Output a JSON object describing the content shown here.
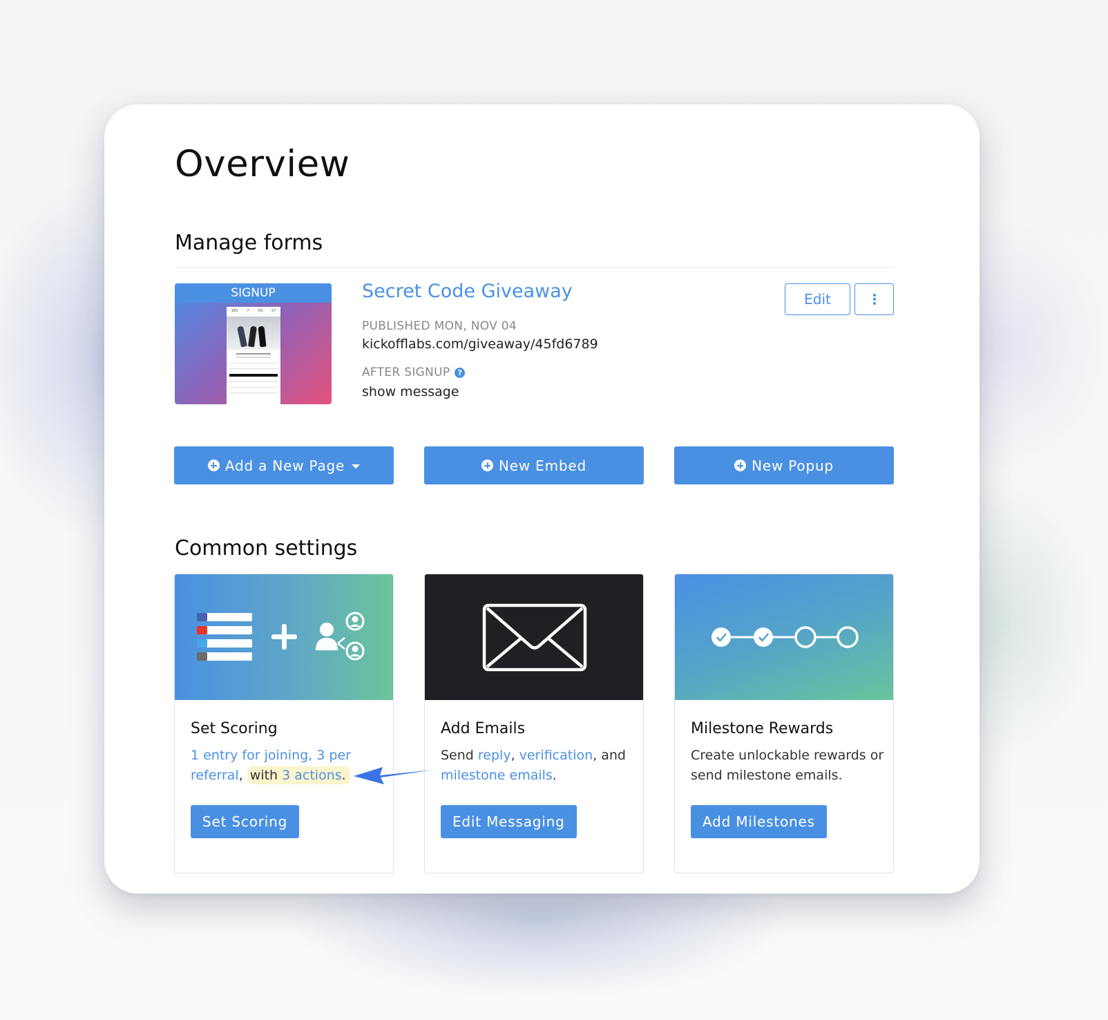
{
  "page": {
    "title": "Overview"
  },
  "manage_forms": {
    "heading": "Manage forms",
    "form": {
      "thumbnail_label": "SIGNUP",
      "title": "Secret Code Giveaway",
      "published_label": "PUBLISHED MON, NOV 04",
      "url": "kickofflabs.com/giveaway/45fd6789",
      "after_signup_label": "AFTER SIGNUP",
      "after_signup_help_icon": "question-circle-icon",
      "after_signup_value": "show message",
      "edit_label": "Edit",
      "more_icon": "vertical-ellipsis-icon"
    },
    "actions": [
      {
        "label": "Add a New Page",
        "icon": "plus-circle-icon",
        "has_dropdown": true
      },
      {
        "label": "New Embed",
        "icon": "plus-circle-icon"
      },
      {
        "label": "New Popup",
        "icon": "plus-circle-icon"
      }
    ]
  },
  "common_settings": {
    "heading": "Common settings",
    "cards": [
      {
        "title": "Set Scoring",
        "banner_icon": "scoring-list-plus-referral-icon",
        "desc_link_1": "1 entry for joining, 3 per referral",
        "desc_mid": ", ",
        "desc_hl_text": "with ",
        "desc_link_2": "3 actions",
        "desc_end": ".",
        "button": "Set Scoring"
      },
      {
        "title": "Add Emails",
        "banner_icon": "envelope-icon",
        "desc_pre": "Send ",
        "desc_link_1": "reply",
        "desc_sep_1": ", ",
        "desc_link_2": "verification",
        "desc_sep_2": ", and ",
        "desc_link_3": "milestone emails",
        "desc_end": ".",
        "button": "Edit Messaging"
      },
      {
        "title": "Milestone Rewards",
        "banner_icon": "milestone-progress-icon",
        "milestones_completed": 2,
        "milestones_total": 4,
        "desc": "Create unlockable rewards or send milestone emails.",
        "button": "Add Milestones"
      }
    ]
  },
  "annotation": {
    "arrow_color": "#3b73e6",
    "highlight_color": "#fbf4cc"
  },
  "colors": {
    "accent": "#4a90e2",
    "text": "#111111",
    "muted": "#888888"
  },
  "thumbnail_phone": {
    "stats": [
      "183",
      "7",
      "59",
      "57"
    ]
  }
}
